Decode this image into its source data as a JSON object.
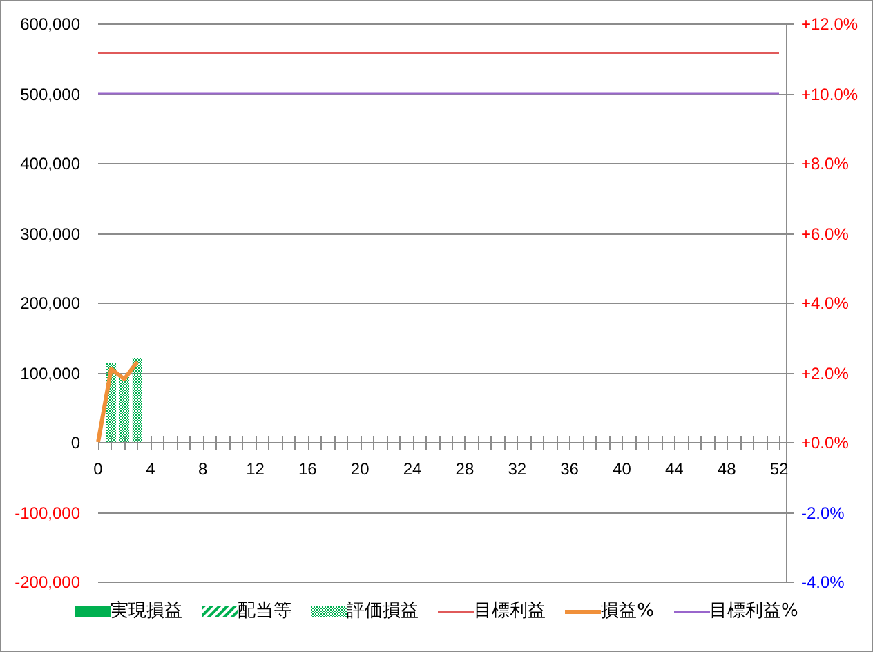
{
  "chart_data": {
    "type": "bar",
    "grid": true,
    "legend": "bottom",
    "x": [
      0,
      1,
      2,
      3,
      4,
      5,
      6,
      7,
      8,
      9,
      10,
      11,
      12,
      13,
      14,
      15,
      16,
      17,
      18,
      19,
      20,
      21,
      22,
      23,
      24,
      25,
      26,
      27,
      28,
      29,
      30,
      31,
      32,
      33,
      34,
      35,
      36,
      37,
      38,
      39,
      40,
      41,
      42,
      43,
      44,
      45,
      46,
      47,
      48,
      49,
      50,
      51,
      52
    ],
    "xlim": [
      0,
      52
    ],
    "xticks": [
      0,
      4,
      8,
      12,
      16,
      20,
      24,
      28,
      32,
      36,
      40,
      44,
      48,
      52
    ],
    "ylim": [
      -200000,
      600000
    ],
    "yticks": [
      {
        "value": 600000,
        "label": "600,000"
      },
      {
        "value": 500000,
        "label": "500,000"
      },
      {
        "value": 400000,
        "label": "400,000"
      },
      {
        "value": 300000,
        "label": "300,000"
      },
      {
        "value": 200000,
        "label": "200,000"
      },
      {
        "value": 100000,
        "label": "100,000"
      },
      {
        "value": 0,
        "label": "0"
      },
      {
        "value": -100000,
        "label": "-100,000"
      },
      {
        "value": -200000,
        "label": "-200,000"
      }
    ],
    "y2lim": [
      -4,
      12
    ],
    "y2ticks": [
      {
        "value": 12,
        "label": "+12.0%"
      },
      {
        "value": 10,
        "label": "+10.0%"
      },
      {
        "value": 8,
        "label": "+8.0%"
      },
      {
        "value": 6,
        "label": "+6.0%"
      },
      {
        "value": 4,
        "label": "+4.0%"
      },
      {
        "value": 2,
        "label": "+2.0%"
      },
      {
        "value": 0,
        "label": "+0.0%"
      },
      {
        "value": -2,
        "label": "-2.0%"
      },
      {
        "value": -4,
        "label": "-4.0%"
      }
    ],
    "series": [
      {
        "name": "実現損益",
        "type": "bar",
        "color": "#00b050",
        "values": [
          null,
          null,
          null,
          null,
          null,
          null,
          null,
          null,
          null,
          null,
          null,
          null,
          null,
          null,
          null,
          null,
          null,
          null,
          null,
          null,
          null,
          null,
          null,
          null,
          null,
          null,
          null,
          null,
          null,
          null,
          null,
          null,
          null,
          null,
          null,
          null,
          null,
          null,
          null,
          null,
          null,
          null,
          null,
          null,
          null,
          null,
          null,
          null,
          null,
          null,
          null,
          null,
          null
        ]
      },
      {
        "name": "配当等",
        "type": "bar",
        "color": "#00b050",
        "values": [
          null,
          null,
          null,
          null,
          null,
          null,
          null,
          null,
          null,
          null,
          null,
          null,
          null,
          null,
          null,
          null,
          null,
          null,
          null,
          null,
          null,
          null,
          null,
          null,
          null,
          null,
          null,
          null,
          null,
          null,
          null,
          null,
          null,
          null,
          null,
          null,
          null,
          null,
          null,
          null,
          null,
          null,
          null,
          null,
          null,
          null,
          null,
          null,
          null,
          null,
          null,
          null,
          null
        ]
      },
      {
        "name": "評価損益",
        "type": "bar",
        "color": "#00b050",
        "values": [
          null,
          113000,
          95000,
          120000,
          null,
          null,
          null,
          null,
          null,
          null,
          null,
          null,
          null,
          null,
          null,
          null,
          null,
          null,
          null,
          null,
          null,
          null,
          null,
          null,
          null,
          null,
          null,
          null,
          null,
          null,
          null,
          null,
          null,
          null,
          null,
          null,
          null,
          null,
          null,
          null,
          null,
          null,
          null,
          null,
          null,
          null,
          null,
          null,
          null,
          null,
          null,
          null,
          null
        ]
      },
      {
        "name": "目標利益",
        "type": "line",
        "color": "#e05a5a",
        "values": [
          558000,
          558000,
          558000,
          558000,
          558000,
          558000,
          558000,
          558000,
          558000,
          558000,
          558000,
          558000,
          558000,
          558000,
          558000,
          558000,
          558000,
          558000,
          558000,
          558000,
          558000,
          558000,
          558000,
          558000,
          558000,
          558000,
          558000,
          558000,
          558000,
          558000,
          558000,
          558000,
          558000,
          558000,
          558000,
          558000,
          558000,
          558000,
          558000,
          558000,
          558000,
          558000,
          558000,
          558000,
          558000,
          558000,
          558000,
          558000,
          558000,
          558000,
          558000,
          558000,
          558000
        ]
      },
      {
        "name": "損益%",
        "type": "line",
        "color": "#f0903a",
        "axis": "y2",
        "values": [
          0,
          2.1,
          1.8,
          2.3,
          null,
          null,
          null,
          null,
          null,
          null,
          null,
          null,
          null,
          null,
          null,
          null,
          null,
          null,
          null,
          null,
          null,
          null,
          null,
          null,
          null,
          null,
          null,
          null,
          null,
          null,
          null,
          null,
          null,
          null,
          null,
          null,
          null,
          null,
          null,
          null,
          null,
          null,
          null,
          null,
          null,
          null,
          null,
          null,
          null,
          null,
          null,
          null,
          null
        ]
      },
      {
        "name": "目標利益%",
        "type": "line",
        "color": "#9966cc",
        "axis": "y2",
        "values": [
          10,
          10,
          10,
          10,
          10,
          10,
          10,
          10,
          10,
          10,
          10,
          10,
          10,
          10,
          10,
          10,
          10,
          10,
          10,
          10,
          10,
          10,
          10,
          10,
          10,
          10,
          10,
          10,
          10,
          10,
          10,
          10,
          10,
          10,
          10,
          10,
          10,
          10,
          10,
          10,
          10,
          10,
          10,
          10,
          10,
          10,
          10,
          10,
          10,
          10,
          10,
          10,
          10
        ]
      }
    ]
  }
}
